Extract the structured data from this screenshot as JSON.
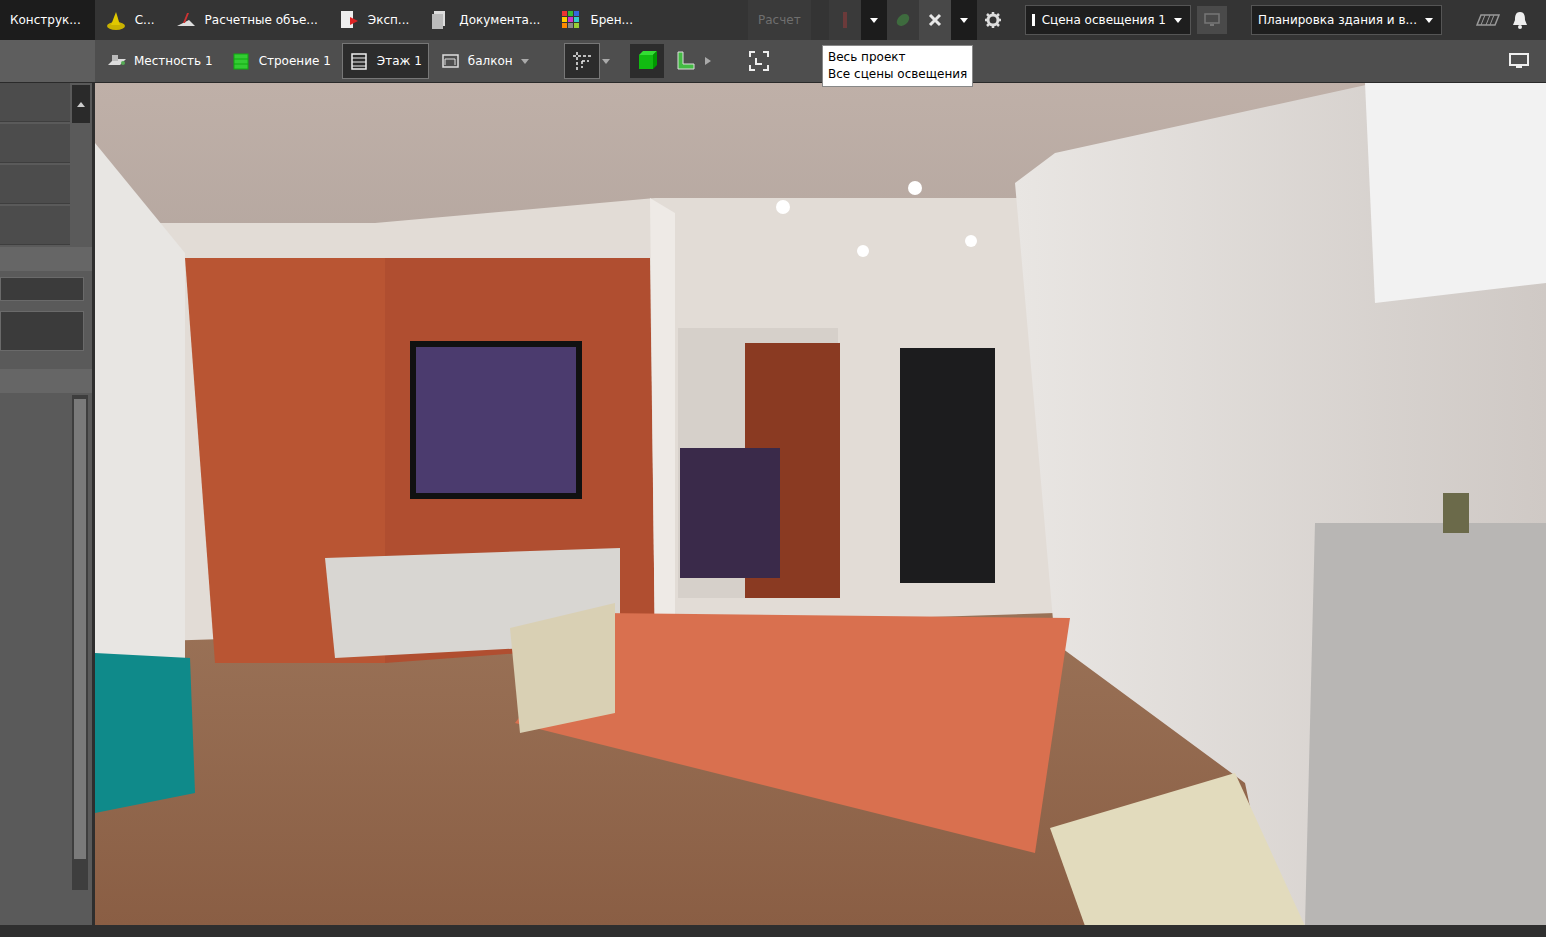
{
  "top_tabs": [
    {
      "label": "Конструк...",
      "selected": true
    },
    {
      "label": "С...",
      "selected": false
    },
    {
      "label": "Расчетные объе...",
      "selected": false
    },
    {
      "label": "Эксп...",
      "selected": false
    },
    {
      "label": "Документа...",
      "selected": false
    },
    {
      "label": "Брен...",
      "selected": false
    }
  ],
  "calc_button": {
    "label": "Расчет",
    "disabled": true
  },
  "scene_select": {
    "value": "Сцена освещения 1"
  },
  "view_select": {
    "value": "Планировка здания и в..."
  },
  "tooltip": {
    "lines": [
      "Весь проект",
      "Все сцены освещения"
    ]
  },
  "levels": [
    {
      "label": "Местность 1",
      "selected": false
    },
    {
      "label": "Строение 1",
      "selected": false
    },
    {
      "label": "Этаж 1",
      "selected": true
    },
    {
      "label": "балкон",
      "selected": false
    }
  ]
}
